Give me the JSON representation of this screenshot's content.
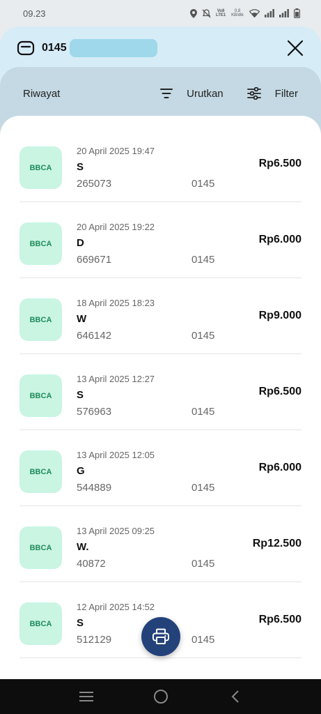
{
  "status_bar": {
    "time": "09.23",
    "speed_value": "0,8",
    "speed_unit": "KB/dtk",
    "volte_label": "Vo8 LTE1"
  },
  "header": {
    "account_prefix": "0145",
    "masked_color": "#9ed8ea"
  },
  "toolbar": {
    "title": "Riwayat",
    "sort_label": "Urutkan",
    "filter_label": "Filter"
  },
  "transactions": [
    {
      "bank": "BBCA",
      "datetime": "20 April 2025 19:47",
      "name": "S",
      "ref": "265073",
      "account": "0145",
      "amount": "Rp6.500"
    },
    {
      "bank": "BBCA",
      "datetime": "20 April 2025 19:22",
      "name": "D",
      "ref": "669671",
      "account": "0145",
      "amount": "Rp6.000"
    },
    {
      "bank": "BBCA",
      "datetime": "18 April 2025 18:23",
      "name": "W",
      "ref": "646142",
      "account": "0145",
      "amount": "Rp9.000"
    },
    {
      "bank": "BBCA",
      "datetime": "13 April 2025 12:27",
      "name": "S",
      "ref": "576963",
      "account": "0145",
      "amount": "Rp6.500"
    },
    {
      "bank": "BBCA",
      "datetime": "13 April 2025 12:05",
      "name": "G",
      "ref": "544889",
      "account": "0145",
      "amount": "Rp6.000"
    },
    {
      "bank": "BBCA",
      "datetime": "13 April 2025 09:25",
      "name": "W.",
      "ref": "40872",
      "account": "0145",
      "amount": "Rp12.500"
    },
    {
      "bank": "BBCA",
      "datetime": "12 April 2025 14:52",
      "name": "S",
      "ref": "512129",
      "account": "0145",
      "amount": "Rp6.500"
    }
  ],
  "colors": {
    "accent_navy": "#23427a",
    "badge_bg": "#c9f5e2",
    "badge_text": "#1f8a5a",
    "header_bg": "#d6ecf7"
  },
  "icons": {
    "wallet": "wallet-icon",
    "close": "close-icon",
    "sort": "sort-icon",
    "filter": "filter-sliders-icon",
    "print": "printer-icon"
  }
}
